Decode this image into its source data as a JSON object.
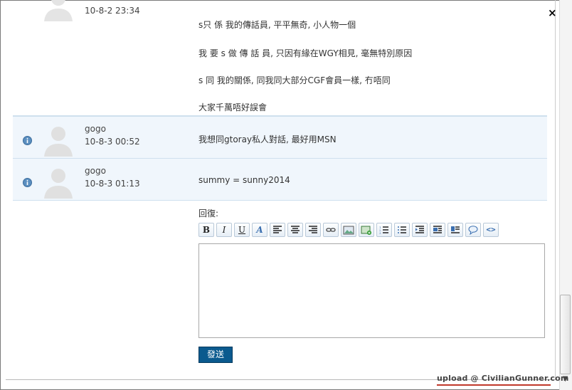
{
  "posts": [
    {
      "time": "10-8-2 23:34",
      "lines": [
        "s只 係 我的傳話員, 平平無奇, 小人物一個",
        "我 要 s 做 傳 話 員, 只因有緣在WGY相見, 毫無特別原因",
        "s 同 我的關係, 同我同大部分CGF會員一樣, 冇唔同",
        "大家千萬唔好誤會"
      ]
    },
    {
      "user": "gogo",
      "time": "10-8-3 00:52",
      "text": "我想同gtoray私人對話, 最好用MSN"
    },
    {
      "user": "gogo",
      "time": "10-8-3 01:13",
      "text": "summy = sunny2014"
    }
  ],
  "reply": {
    "label": "回復:",
    "send_label": "發送",
    "toolbar": [
      "bold-icon",
      "italic-icon",
      "underline-icon",
      "font-color-icon",
      "align-left-icon",
      "align-center-icon",
      "align-right-icon",
      "link-icon",
      "image-icon",
      "insert-image-icon",
      "ordered-list-icon",
      "unordered-list-icon",
      "indent-icon",
      "float-left-icon",
      "float-right-icon",
      "quote-icon",
      "code-icon"
    ]
  },
  "watermark": "upload @ CivilianGunner.com",
  "close_label": "×"
}
